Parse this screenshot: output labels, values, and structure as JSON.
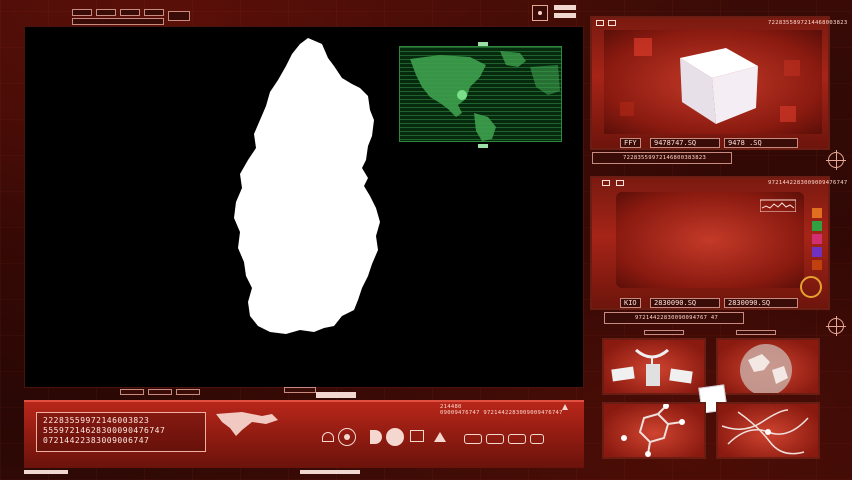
{
  "main": {
    "map_subject": "Qatar",
    "bottom_codes": [
      "22283559972146003823",
      "55597214628300090476747",
      "07214422383009006747"
    ]
  },
  "world_map": {
    "region": "North America"
  },
  "bottom_bar": {
    "small_code_a": "214480",
    "small_code_b": "09009476747 9721442283009009476747"
  },
  "cube_panel": {
    "header_code": "7228355897214468003823",
    "tag": "FFY",
    "value_a": "9478747.SQ",
    "value_b": "9478 .SQ",
    "footer_code": "72283559972146800383823"
  },
  "graph_panel": {
    "header_code": "9721442283009009476747",
    "tag": "KIO",
    "value_a": "2830090.SQ",
    "value_b": "2830090.SQ",
    "footer_code": "97214422830090094767 47",
    "swatch_colors": [
      "#e07020",
      "#30a040",
      "#d03070",
      "#7030c0",
      "#c04010"
    ]
  },
  "thumbnails": {
    "items": [
      "satellite",
      "earth-globe",
      "molecule",
      "neural-network"
    ]
  },
  "colors": {
    "accent": "#b8261a",
    "map_green": "#2c8a3a",
    "screen_black": "#000000"
  }
}
